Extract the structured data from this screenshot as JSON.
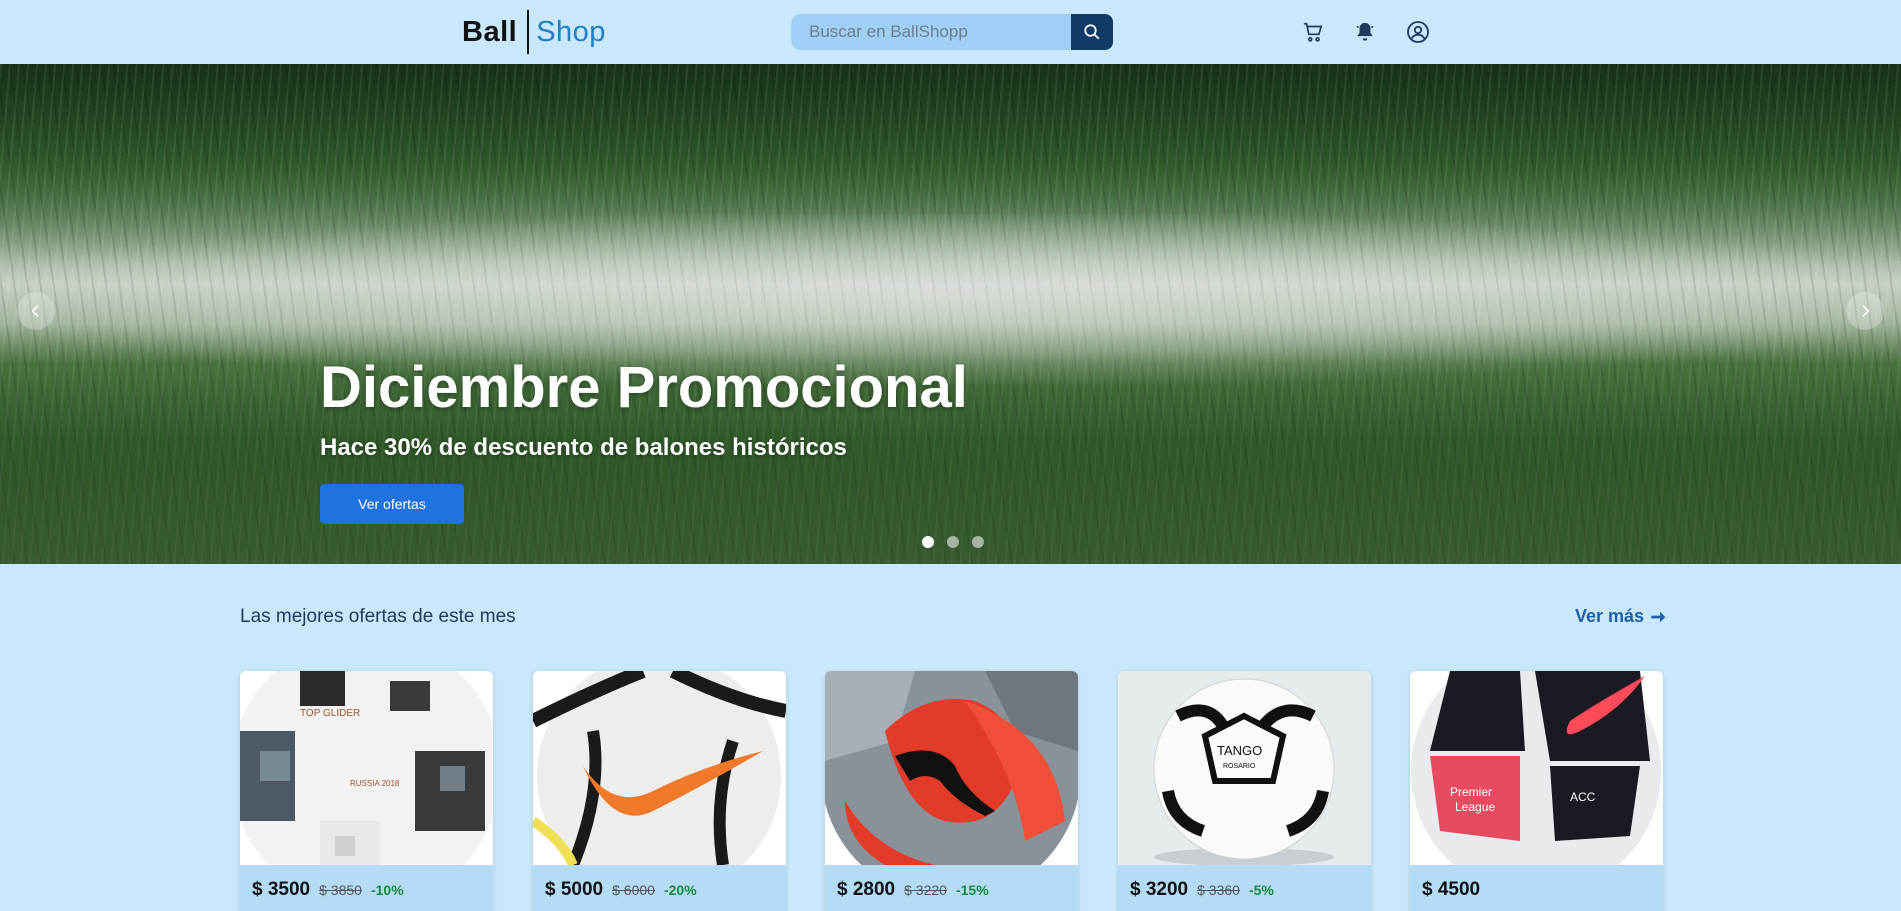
{
  "header": {
    "logo_left": "Ball",
    "logo_right": "Shop",
    "search_placeholder": "Buscar en BallShopp",
    "icons": [
      "search-icon",
      "cart-icon",
      "bell-icon",
      "user-icon"
    ]
  },
  "hero": {
    "title": "Diciembre Promocional",
    "subtitle": "Hace 30% de descuento de balones históricos",
    "button_label": "Ver ofertas",
    "slides": 3,
    "active_slide": 1
  },
  "offers": {
    "title": "Las mejores ofertas de este mes",
    "see_more": "Ver más",
    "products": [
      {
        "price": "$ 3500",
        "old_price": "$ 3850",
        "discount": "-10%",
        "image": "adidas-telstar-ball"
      },
      {
        "price": "$ 5000",
        "old_price": "$ 6000",
        "discount": "-20%",
        "image": "nike-strike-ball"
      },
      {
        "price": "$ 2800",
        "old_price": "$ 3220",
        "discount": "-15%",
        "image": "puma-red-ball"
      },
      {
        "price": "$ 3200",
        "old_price": "$ 3360",
        "discount": "-5%",
        "image": "adidas-tango-ball"
      },
      {
        "price": "$ 4500",
        "old_price": "",
        "discount": "",
        "image": "nike-premier-league-ball"
      }
    ]
  },
  "colors": {
    "background": "#c9e8fb",
    "accent": "#1f72e0",
    "search_button": "#123a66",
    "discount": "#168a3a"
  }
}
